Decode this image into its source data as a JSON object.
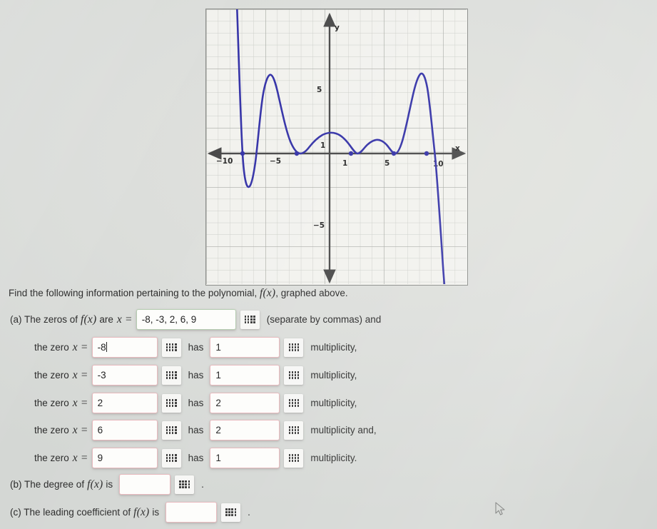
{
  "prompt": {
    "text_before": "Find the following information pertaining to the polynomial,",
    "fx": "f(x)",
    "text_after": ", graphed above."
  },
  "part_a": {
    "label": "(a) The zeros of",
    "fx": "f(x)",
    "are": "are",
    "x_eq": "x =",
    "zeros_value": "-8, -3, 2, 6, 9",
    "hint": "(separate by commas) and",
    "rows": [
      {
        "prefix": "the zero",
        "x_eq": "x =",
        "zero": "-8",
        "has": "has",
        "multiplicity": "1",
        "suffix": "multiplicity,"
      },
      {
        "prefix": "the zero",
        "x_eq": "x =",
        "zero": "-3",
        "has": "has",
        "multiplicity": "1",
        "suffix": "multiplicity,"
      },
      {
        "prefix": "the zero",
        "x_eq": "x =",
        "zero": "2",
        "has": "has",
        "multiplicity": "2",
        "suffix": "multiplicity,"
      },
      {
        "prefix": "the zero",
        "x_eq": "x =",
        "zero": "6",
        "has": "has",
        "multiplicity": "2",
        "suffix": "multiplicity and,"
      },
      {
        "prefix": "the zero",
        "x_eq": "x =",
        "zero": "9",
        "has": "has",
        "multiplicity": "1",
        "suffix": "multiplicity."
      }
    ]
  },
  "part_b": {
    "label_before": "(b) The degree of",
    "fx": "f(x)",
    "label_after": "is",
    "value": "",
    "period": "."
  },
  "part_c": {
    "label_before": "(c) The leading coefficient of",
    "fx": "f(x)",
    "label_after": "is",
    "value": "",
    "period": "."
  },
  "icons": {
    "keypad": "keypad-icon",
    "cursor": "mouse-cursor-icon"
  },
  "colors": {
    "curve": "#3634a8",
    "axis": "#4a4a4a",
    "grid_minor": "#c9cbc6",
    "grid_major": "#aaaca7",
    "graph_bg": "#f2f2ee",
    "page_bg": "#dcdedb",
    "field_border_wrong": "#e8b9bd",
    "field_border_ok": "#b4ccb0"
  },
  "chart_data": {
    "type": "line",
    "title": "",
    "xlabel": "x",
    "ylabel": "y",
    "xlim": [
      -11.5,
      11.5
    ],
    "ylim": [
      -11.5,
      11.5
    ],
    "grid": true,
    "x_tick_labels": [
      {
        "value": -10,
        "label": "-10"
      },
      {
        "value": -5,
        "label": "-5"
      },
      {
        "value": 1,
        "label": "1"
      },
      {
        "value": 5,
        "label": "5"
      },
      {
        "value": 10,
        "label": "10"
      }
    ],
    "y_tick_labels": [
      {
        "value": 5,
        "label": "5"
      },
      {
        "value": 1,
        "label": "1"
      },
      {
        "value": -5,
        "label": "-5"
      }
    ],
    "zeros": [
      -8,
      -3,
      2,
      6,
      9
    ],
    "zero_multiplicities": [
      1,
      1,
      2,
      2,
      1
    ],
    "annotations": [
      "x-intercept marked at x = -8",
      "x-intercept marked at x = -3",
      "x-intercept (tangent) marked at x = 2",
      "x-intercept (tangent) marked at x = 6",
      "x-intercept marked at x = 9"
    ],
    "series": [
      {
        "name": "f(x)",
        "color": "#3634a8",
        "description": "Degree-7 polynomial with negative leading coefficient: rises steeply from upper-left, crosses at x=-8, local max near y=7.3 at x=-6.2, crosses at x=-3, local max y=1.2 near x=0, touches axis at x=2, local max y=0.8 near x=4, touches axis at x=6, local max y=7.5 near x=8.3, crosses at x=9 and falls steeply",
        "x": [
          -8.6,
          -8.4,
          -8.2,
          -8.0,
          -7.8,
          -7.6,
          -7.4,
          -7.2,
          -7.0,
          -6.8,
          -6.6,
          -6.4,
          -6.2,
          -6.0,
          -5.6,
          -5.2,
          -4.8,
          -4.4,
          -4.0,
          -3.6,
          -3.2,
          -3.0,
          -2.6,
          -2.2,
          -1.8,
          -1.2,
          -0.6,
          0.0,
          0.6,
          1.2,
          1.6,
          2.0,
          2.4,
          3.0,
          3.6,
          4.0,
          4.6,
          5.2,
          5.6,
          6.0,
          6.4,
          6.8,
          7.2,
          7.6,
          8.0,
          8.3,
          8.6,
          8.8,
          9.0,
          9.2,
          9.4
        ],
        "y": [
          11.0,
          6.0,
          2.2,
          0.0,
          -1.0,
          -1.4,
          -1.2,
          -0.5,
          1.0,
          3.0,
          5.2,
          6.8,
          7.3,
          7.1,
          6.0,
          4.6,
          3.2,
          1.8,
          0.8,
          0.2,
          0.0,
          0.0,
          0.25,
          0.7,
          1.0,
          1.2,
          1.25,
          1.2,
          1.0,
          0.6,
          0.2,
          0.0,
          0.15,
          0.55,
          0.78,
          0.8,
          0.7,
          0.4,
          0.15,
          0.0,
          0.3,
          1.2,
          2.8,
          5.2,
          7.1,
          7.5,
          6.0,
          3.2,
          0.0,
          -5.0,
          -11.0
        ]
      }
    ]
  }
}
